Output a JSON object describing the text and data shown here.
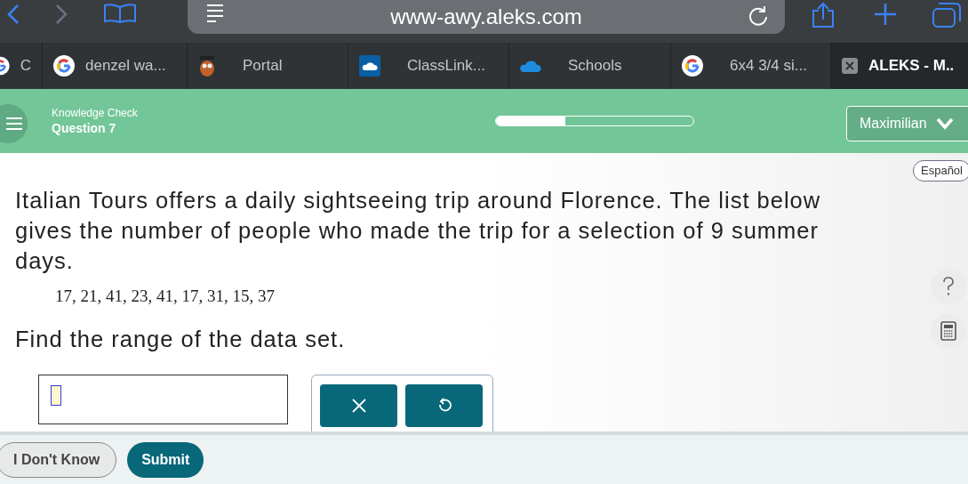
{
  "browser": {
    "url": "www-awy.aleks.com"
  },
  "tabs": [
    {
      "label": "C",
      "kind": "google",
      "selected": false
    },
    {
      "label": "denzel wa...",
      "kind": "google",
      "selected": false
    },
    {
      "label": "Portal",
      "kind": "owl",
      "selected": false
    },
    {
      "label": "ClassLink...",
      "kind": "cloud",
      "selected": false
    },
    {
      "label": "Schools",
      "kind": "cloud2",
      "selected": false
    },
    {
      "label": "6x4 3/4 si...",
      "kind": "google",
      "selected": false
    },
    {
      "label": "ALEKS - M..",
      "kind": "close",
      "selected": true
    }
  ],
  "header": {
    "subtitle": "Knowledge Check",
    "title": "Question 7",
    "progress": {
      "level": 0.35
    },
    "user": "Maximilian"
  },
  "language_button": "Español",
  "question": {
    "text": "Italian Tours offers a daily sightseeing trip around Florence. The list below gives the number of people who made the trip for a selection of 9 summer days.",
    "data": "17, 21, 41, 23, 41, 17, 31, 15, 37",
    "prompt": "Find the range of the data set."
  },
  "footer": {
    "buttons": [
      "I Don't Know",
      "Submit"
    ]
  }
}
